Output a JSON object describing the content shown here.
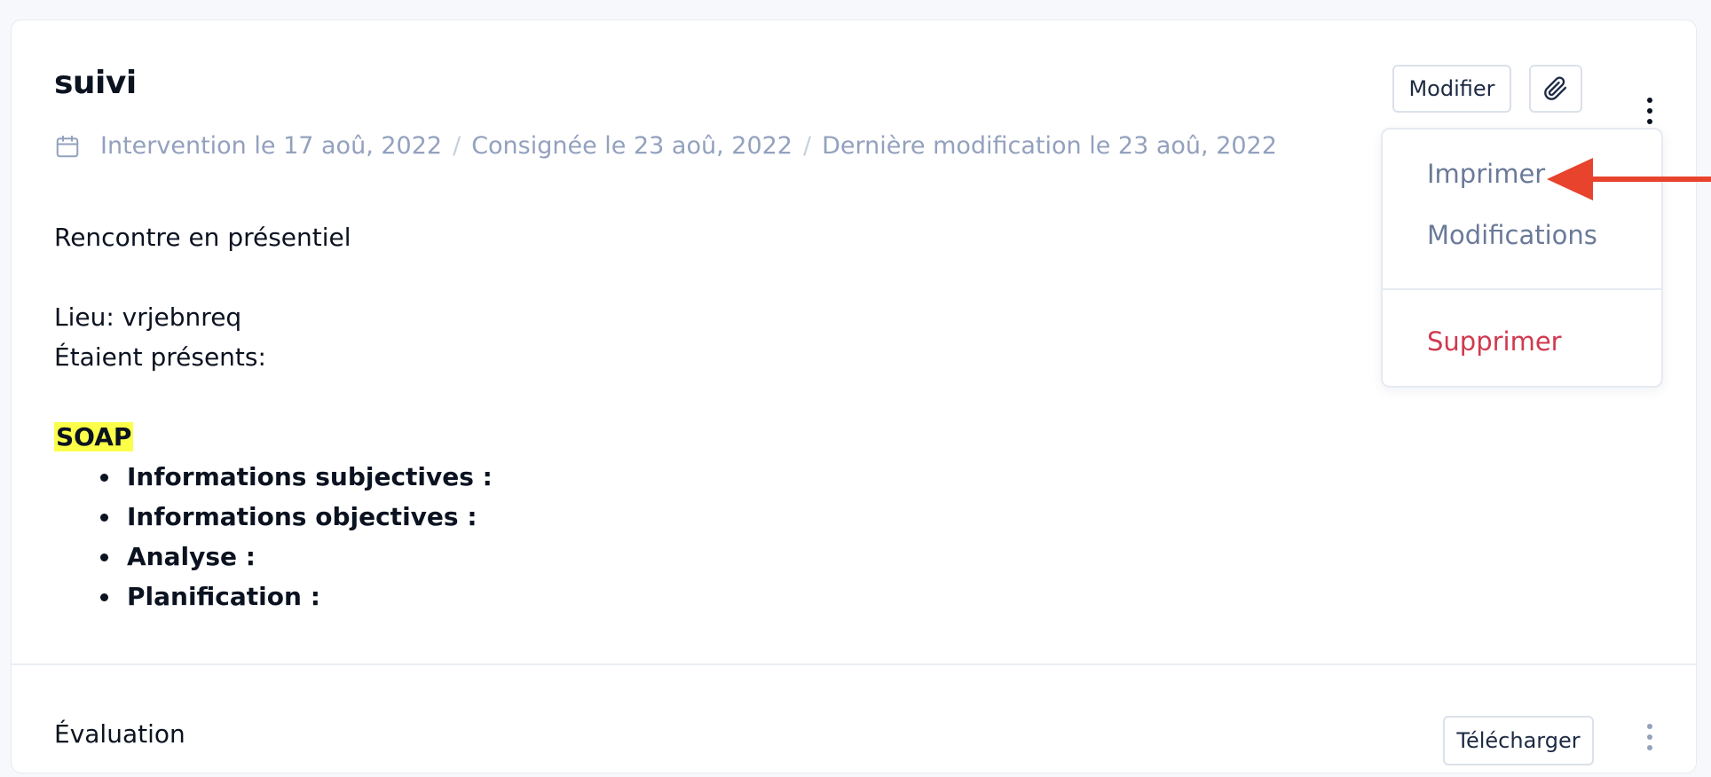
{
  "note": {
    "title": "suivi",
    "meta": {
      "intervention": "Intervention le 17 aoû, 2022",
      "logged": "Consignée le 23 aoû, 2022",
      "modified": "Dernière modification le 23 aoû, 2022",
      "separator": "/"
    },
    "actions": {
      "edit_label": "Modifier",
      "attach_icon": "paperclip-icon",
      "more_icon": "kebab-menu-icon"
    },
    "menu": {
      "items": [
        {
          "label": "Imprimer",
          "color": "#6b7a99"
        },
        {
          "label": "Modifications",
          "color": "#6b7a99"
        },
        {
          "label": "Supprimer",
          "color": "#d0394f"
        }
      ]
    },
    "content": {
      "line1": "Rencontre en présentiel",
      "location": "Lieu: vrjebnreq",
      "attendees": "Étaient présents:",
      "soap_heading": "SOAP",
      "soap_items": [
        "Informations subjectives :",
        "Informations objectives :",
        "Analyse :",
        "Planification :"
      ]
    }
  },
  "attachment": {
    "name": "Évaluation",
    "download_label": "Télécharger"
  },
  "colors": {
    "highlight": "#fbff4a",
    "danger": "#d0394f",
    "muted": "#93a1be",
    "annotation_arrow": "#e8432d"
  }
}
